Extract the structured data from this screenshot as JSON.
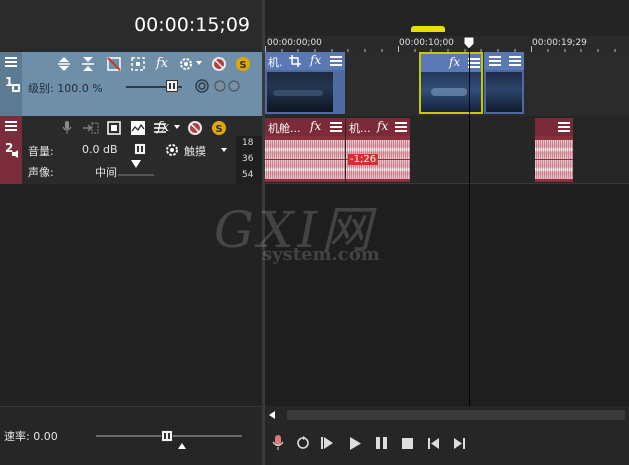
{
  "timecode": "00:00:15;09",
  "ruler": {
    "labels": [
      "00:00:00;00",
      "00:00:10;00",
      "00:00:19;29"
    ]
  },
  "video_track": {
    "number": "1",
    "level_label": "级别: 100.0 %",
    "fx_label": "fx"
  },
  "audio_track": {
    "number": "2",
    "volume_label": "音量:",
    "volume_value": "0.0 dB",
    "pan_label": "声像:",
    "pan_value": "中间",
    "touch_label": "触摸",
    "meter_ticks": [
      "18",
      "36",
      "54"
    ],
    "fx_label": "fx"
  },
  "video_clips": [
    {
      "title": "机.",
      "fx": "fx"
    },
    {
      "title": "",
      "fx": "fx"
    },
    {
      "title": "",
      "fx": ""
    }
  ],
  "audio_clips": [
    {
      "title": "机舱...",
      "fx": "fx"
    },
    {
      "title": "机...",
      "fx": "fx",
      "badge": "-1;26"
    },
    {
      "title": "",
      "fx": ""
    }
  ],
  "watermark": {
    "brand": "GXI网",
    "sub": "system.com"
  },
  "rate_label": "速率: 0.00",
  "colors": {
    "video_track": "#6f8fa8",
    "audio_track": "#7a2e3c",
    "video_clip_header": "#5a79b4",
    "audio_clip_header": "#8a2f3d",
    "selected_clip": "#c8c800",
    "cursor": "#000000"
  }
}
